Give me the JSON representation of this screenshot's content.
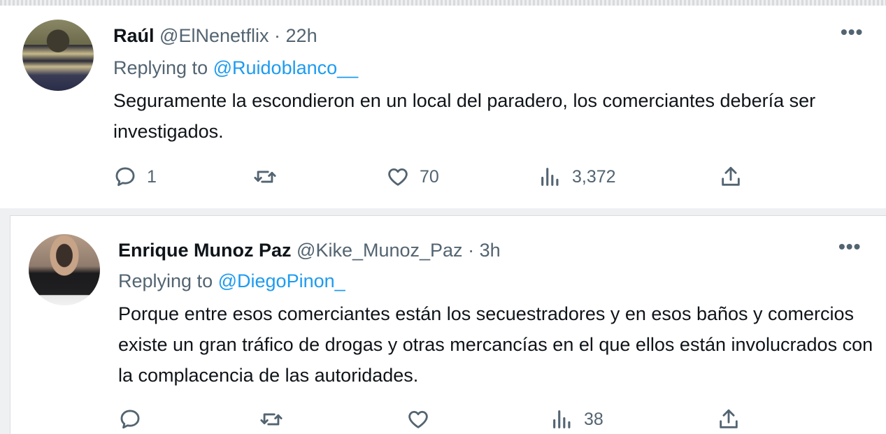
{
  "tweets": [
    {
      "display_name": "Raúl",
      "handle": "@ElNenetflix",
      "separator": "·",
      "time": "22h",
      "replying_prefix": "Replying to",
      "replying_to": "@Ruidoblanco__",
      "text": "Seguramente la escondieron en un local del paradero, los comerciantes debería ser investigados.",
      "replies": "1",
      "retweets": "",
      "likes": "70",
      "views": "3,372"
    },
    {
      "display_name": "Enrique Munoz Paz",
      "handle": "@Kike_Munoz_Paz",
      "separator": "·",
      "time": "3h",
      "replying_prefix": "Replying to",
      "replying_to": "@DiegoPinon_",
      "text": "Porque entre esos comerciantes están los secuestradores y en esos baños y comercios existe un gran tráfico de drogas y otras mercancías en el que ellos están involucrados con la complacencia de las autoridades.",
      "replies": "",
      "retweets": "",
      "likes": "",
      "views": "38"
    }
  ],
  "more_label": "•••",
  "icons": {
    "reply": "reply-icon",
    "retweet": "retweet-icon",
    "like": "like-icon",
    "views": "views-icon",
    "share": "share-icon",
    "more": "more-icon"
  },
  "colors": {
    "accent": "#1d9bf0",
    "secondary_text": "#536471",
    "primary_text": "#0f1419"
  }
}
